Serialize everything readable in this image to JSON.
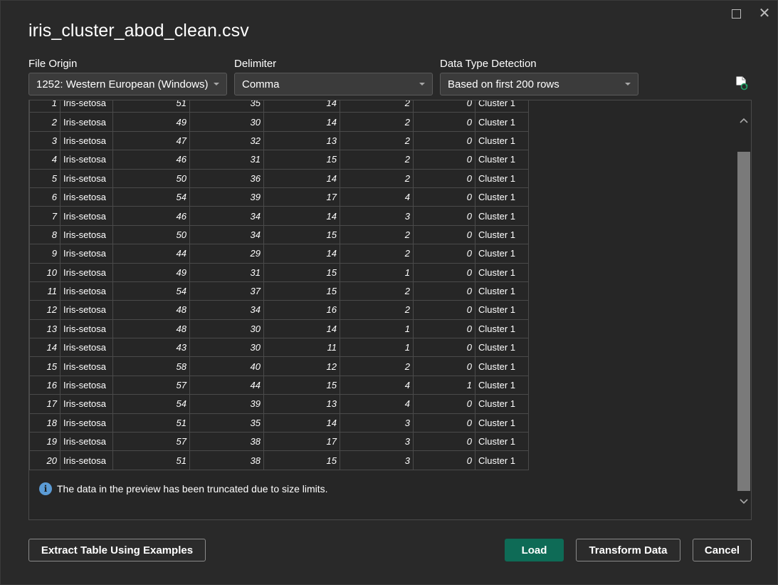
{
  "window": {
    "title": "iris_cluster_abod_clean.csv"
  },
  "controls": {
    "file_origin": {
      "label": "File Origin",
      "value": "1252: Western European (Windows)"
    },
    "delimiter": {
      "label": "Delimiter",
      "value": "Comma"
    },
    "data_type_detection": {
      "label": "Data Type Detection",
      "value": "Based on first 200 rows"
    }
  },
  "table": {
    "rows": [
      [
        "1",
        "Iris-setosa",
        "51",
        "35",
        "14",
        "2",
        "0",
        "Cluster 1"
      ],
      [
        "2",
        "Iris-setosa",
        "49",
        "30",
        "14",
        "2",
        "0",
        "Cluster 1"
      ],
      [
        "3",
        "Iris-setosa",
        "47",
        "32",
        "13",
        "2",
        "0",
        "Cluster 1"
      ],
      [
        "4",
        "Iris-setosa",
        "46",
        "31",
        "15",
        "2",
        "0",
        "Cluster 1"
      ],
      [
        "5",
        "Iris-setosa",
        "50",
        "36",
        "14",
        "2",
        "0",
        "Cluster 1"
      ],
      [
        "6",
        "Iris-setosa",
        "54",
        "39",
        "17",
        "4",
        "0",
        "Cluster 1"
      ],
      [
        "7",
        "Iris-setosa",
        "46",
        "34",
        "14",
        "3",
        "0",
        "Cluster 1"
      ],
      [
        "8",
        "Iris-setosa",
        "50",
        "34",
        "15",
        "2",
        "0",
        "Cluster 1"
      ],
      [
        "9",
        "Iris-setosa",
        "44",
        "29",
        "14",
        "2",
        "0",
        "Cluster 1"
      ],
      [
        "10",
        "Iris-setosa",
        "49",
        "31",
        "15",
        "1",
        "0",
        "Cluster 1"
      ],
      [
        "11",
        "Iris-setosa",
        "54",
        "37",
        "15",
        "2",
        "0",
        "Cluster 1"
      ],
      [
        "12",
        "Iris-setosa",
        "48",
        "34",
        "16",
        "2",
        "0",
        "Cluster 1"
      ],
      [
        "13",
        "Iris-setosa",
        "48",
        "30",
        "14",
        "1",
        "0",
        "Cluster 1"
      ],
      [
        "14",
        "Iris-setosa",
        "43",
        "30",
        "11",
        "1",
        "0",
        "Cluster 1"
      ],
      [
        "15",
        "Iris-setosa",
        "58",
        "40",
        "12",
        "2",
        "0",
        "Cluster 1"
      ],
      [
        "16",
        "Iris-setosa",
        "57",
        "44",
        "15",
        "4",
        "1",
        "Cluster 1"
      ],
      [
        "17",
        "Iris-setosa",
        "54",
        "39",
        "13",
        "4",
        "0",
        "Cluster 1"
      ],
      [
        "18",
        "Iris-setosa",
        "51",
        "35",
        "14",
        "3",
        "0",
        "Cluster 1"
      ],
      [
        "19",
        "Iris-setosa",
        "57",
        "38",
        "17",
        "3",
        "0",
        "Cluster 1"
      ],
      [
        "20",
        "Iris-setosa",
        "51",
        "38",
        "15",
        "3",
        "0",
        "Cluster 1"
      ]
    ]
  },
  "info": {
    "message": "The data in the preview has been truncated due to size limits."
  },
  "buttons": {
    "extract": "Extract Table Using Examples",
    "load": "Load",
    "transform": "Transform Data",
    "cancel": "Cancel"
  },
  "colors": {
    "primary_button": "#0e6b56",
    "info_icon": "#5b9bd5",
    "background": "#292929"
  },
  "icons": [
    "maximize-icon",
    "close-icon",
    "chevron-down-icon",
    "refresh-file-icon",
    "info-icon",
    "scroll-up-icon",
    "scroll-down-icon"
  ]
}
